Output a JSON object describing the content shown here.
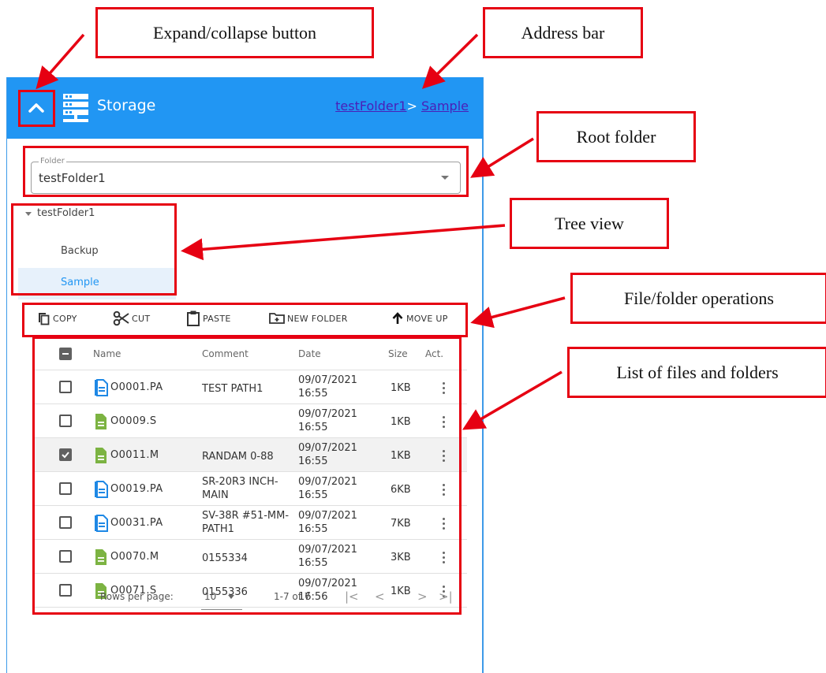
{
  "annotations": {
    "expand": "Expand/collapse button",
    "address": "Address bar",
    "root": "Root folder",
    "tree": "Tree view",
    "ops": "File/folder operations",
    "list": "List of files and folders"
  },
  "header": {
    "title": "Storage",
    "breadcrumb": {
      "root": "testFolder1",
      "separator": ">",
      "current": "Sample"
    },
    "expand_icon": "chevron-up-icon",
    "storage_icon": "server-icon"
  },
  "folder_select": {
    "legend": "Folder",
    "value": "testFolder1"
  },
  "tree": {
    "root": "testFolder1",
    "children": [
      {
        "label": "Backup",
        "selected": false
      },
      {
        "label": "Sample",
        "selected": true
      }
    ]
  },
  "toolbar": {
    "copy": "COPY",
    "cut": "CUT",
    "paste": "PASTE",
    "new_folder": "NEW FOLDER",
    "move_up": "MOVE UP"
  },
  "table": {
    "columns": {
      "name": "Name",
      "comment": "Comment",
      "date": "Date",
      "size": "Size",
      "action": "Act."
    },
    "rows": [
      {
        "name": "O0001.PA",
        "comment": "TEST PATH1",
        "date": "09/07/2021 16:55",
        "size": "1KB",
        "type": "blue",
        "checked": false
      },
      {
        "name": "O0009.S",
        "comment": "",
        "date": "09/07/2021 16:55",
        "size": "1KB",
        "type": "green",
        "checked": false
      },
      {
        "name": "O0011.M",
        "comment": "RANDAM 0-88",
        "date": "09/07/2021 16:55",
        "size": "1KB",
        "type": "green",
        "checked": true
      },
      {
        "name": "O0019.PA",
        "comment": "SR-20R3 INCH-MAIN",
        "date": "09/07/2021 16:55",
        "size": "6KB",
        "type": "blue",
        "checked": false
      },
      {
        "name": "O0031.PA",
        "comment": "SV-38R #51-MM-PATH1",
        "date": "09/07/2021 16:55",
        "size": "7KB",
        "type": "blue",
        "checked": false
      },
      {
        "name": "O0070.M",
        "comment": "0155334",
        "date": "09/07/2021 16:55",
        "size": "3KB",
        "type": "green",
        "checked": false
      },
      {
        "name": "O0071.S",
        "comment": "0155336",
        "date": "09/07/2021 16:56",
        "size": "1KB",
        "type": "green",
        "checked": false
      }
    ]
  },
  "pagination": {
    "rows_label": "Rows per page:",
    "rows_value": "10",
    "range": "1-7 of 7"
  },
  "colors": {
    "header_blue": "#2196f3",
    "annotation_red": "#e60012",
    "file_blue": "#1e88e5",
    "file_green": "#7cb342"
  }
}
